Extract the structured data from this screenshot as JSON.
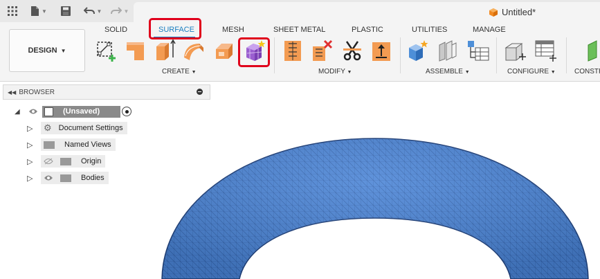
{
  "title_bar": {
    "document_title": "Untitled*"
  },
  "workspace": {
    "label": "DESIGN"
  },
  "tabs": [
    {
      "label": "SOLID",
      "active": false
    },
    {
      "label": "SURFACE",
      "active": true
    },
    {
      "label": "MESH",
      "active": false
    },
    {
      "label": "SHEET METAL",
      "active": false
    },
    {
      "label": "PLASTIC",
      "active": false
    },
    {
      "label": "UTILITIES",
      "active": false
    },
    {
      "label": "MANAGE",
      "active": false
    }
  ],
  "groups": {
    "create": "CREATE",
    "modify": "MODIFY",
    "assemble": "ASSEMBLE",
    "configure": "CONFIGURE",
    "construct": "CONSTR"
  },
  "browser": {
    "header": "BROWSER",
    "root": "(Unsaved)",
    "items": [
      {
        "label": "Document Settings",
        "icon": "gear-icon"
      },
      {
        "label": "Named Views",
        "icon": "folder-icon"
      },
      {
        "label": "Origin",
        "icon": "folder-icon",
        "visibility": "hidden"
      },
      {
        "label": "Bodies",
        "icon": "folder-icon",
        "visibility": "visible"
      }
    ]
  },
  "colors": {
    "accent": "#1a7fc1",
    "highlight": "#e0001b",
    "mesh": "#4a84d6"
  }
}
